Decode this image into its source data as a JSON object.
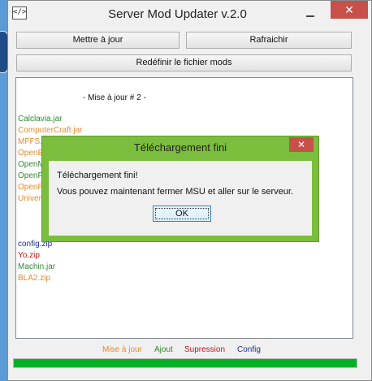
{
  "window": {
    "title": "Server Mod Updater  v.2.0",
    "icon": "code-icon",
    "close_glyph": "✕"
  },
  "toolbar": {
    "update_label": "Mettre à jour",
    "refresh_label": "Rafraichir",
    "redefine_label": "Redéfinir le fichier mods"
  },
  "panel": {
    "heading": "- Mise à jour # 2 -",
    "items": [
      {
        "text": "Calclavia.jar",
        "status": "ajout"
      },
      {
        "text": "ComputerCraft.jar",
        "status": "mise-a-jour"
      },
      {
        "text": "MFFS.",
        "status": "mise-a-jour"
      },
      {
        "text": "OpenB",
        "status": "mise-a-jour"
      },
      {
        "text": "OpenM",
        "status": "ajout"
      },
      {
        "text": "OpenP",
        "status": "ajout"
      },
      {
        "text": "OpenP",
        "status": "mise-a-jour"
      },
      {
        "text": "Univer",
        "status": "mise-a-jour"
      }
    ],
    "items2": [
      {
        "text": "config.zip",
        "status": "config"
      },
      {
        "text": "Yo.zip",
        "status": "supression"
      },
      {
        "text": "Machin.jar",
        "status": "ajout"
      },
      {
        "text": "BLA2.zip",
        "status": "mise-a-jour"
      }
    ]
  },
  "legend": {
    "update": "Mise à jour",
    "add": "Ajout",
    "remove": "Supression",
    "config": "Config"
  },
  "colors": {
    "update": "#e8892a",
    "add": "#2f8a2f",
    "remove": "#c01818",
    "config": "#1a2f9c",
    "accent": "#7bbd3d"
  },
  "progress": {
    "percent": 100
  },
  "dialog": {
    "title": "Téléchargement fini",
    "line1": "Téléchargement fini!",
    "line2": "Vous pouvez maintenant fermer MSU et aller sur le serveur.",
    "ok_label": "OK",
    "close_glyph": "✕"
  }
}
